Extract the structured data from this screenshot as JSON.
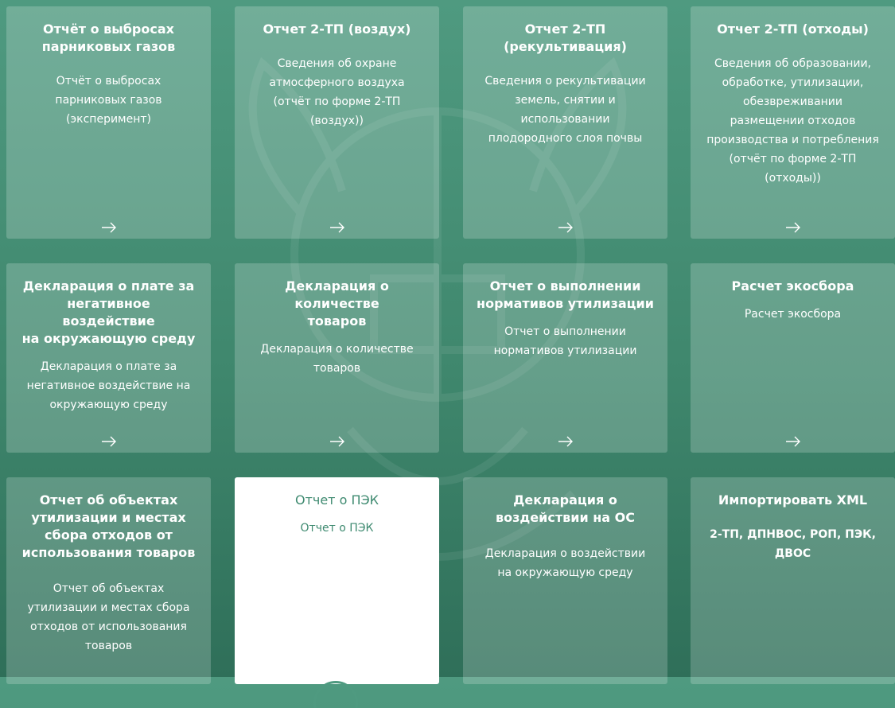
{
  "cards": [
    {
      "title": "Отчёт о выбросах\nпарниковых газов",
      "description": "Отчёт о выбросах\nпарниковых газов\n(эксперимент)"
    },
    {
      "title": "Отчет 2-ТП (воздух)",
      "description": "Сведения об охране\nатмосферного воздуха\n(отчёт по форме 2-ТП\n(воздух))"
    },
    {
      "title": "Отчет 2-ТП\n(рекультивация)",
      "description": "Сведения о рекультивации\nземель, снятии и\nиспользовании\nплодородного слоя почвы"
    },
    {
      "title": "Отчет 2-ТП (отходы)",
      "description": "Сведения об образовании,\nобработке, утилизации,\nобезвреживании\nразмещении отходов\nпроизводства и потребления\n(отчёт по форме 2-ТП\n(отходы))"
    },
    {
      "title": "Декларация о плате за\nнегативное воздействие\nна окружающую среду",
      "description": "Декларация о плате за\nнегативное воздействие на\nокружающую среду"
    },
    {
      "title": "Декларация о количестве\nтоваров",
      "description": "Декларация о количестве\nтоваров"
    },
    {
      "title": "Отчет о выполнении\nнормативов утилизации",
      "description": "Отчет о выполнении\nнормативов утилизации"
    },
    {
      "title": "Расчет экосбора",
      "description": "Расчет экосбора"
    },
    {
      "title": "Отчет об объектах\nутилизации и местах\nсбора отходов от\nиспользования товаров",
      "description": "Отчет об объектах\nутилизации и местах сбора\nотходов от использования\nтоваров"
    },
    {
      "title": "Отчет о ПЭК",
      "description": "Отчет о ПЭК"
    },
    {
      "title": "Декларация о\nвоздействии на ОС",
      "description": "Декларация о воздействии\nна окружающую среду"
    },
    {
      "title": "Импортировать XML",
      "description": "2-ТП, ДПНВОС, РОП, ПЭК,\nДВОС"
    }
  ],
  "icons": {
    "arrow": "arrow-right-icon",
    "loader": "loading-spinner-icon",
    "background": "emblem-watermark"
  },
  "colors": {
    "accent": "#3e8a70",
    "card_active_bg": "#ffffff",
    "card_bg": "rgba(255,255,255,0.20)",
    "text": "#ffffff"
  }
}
